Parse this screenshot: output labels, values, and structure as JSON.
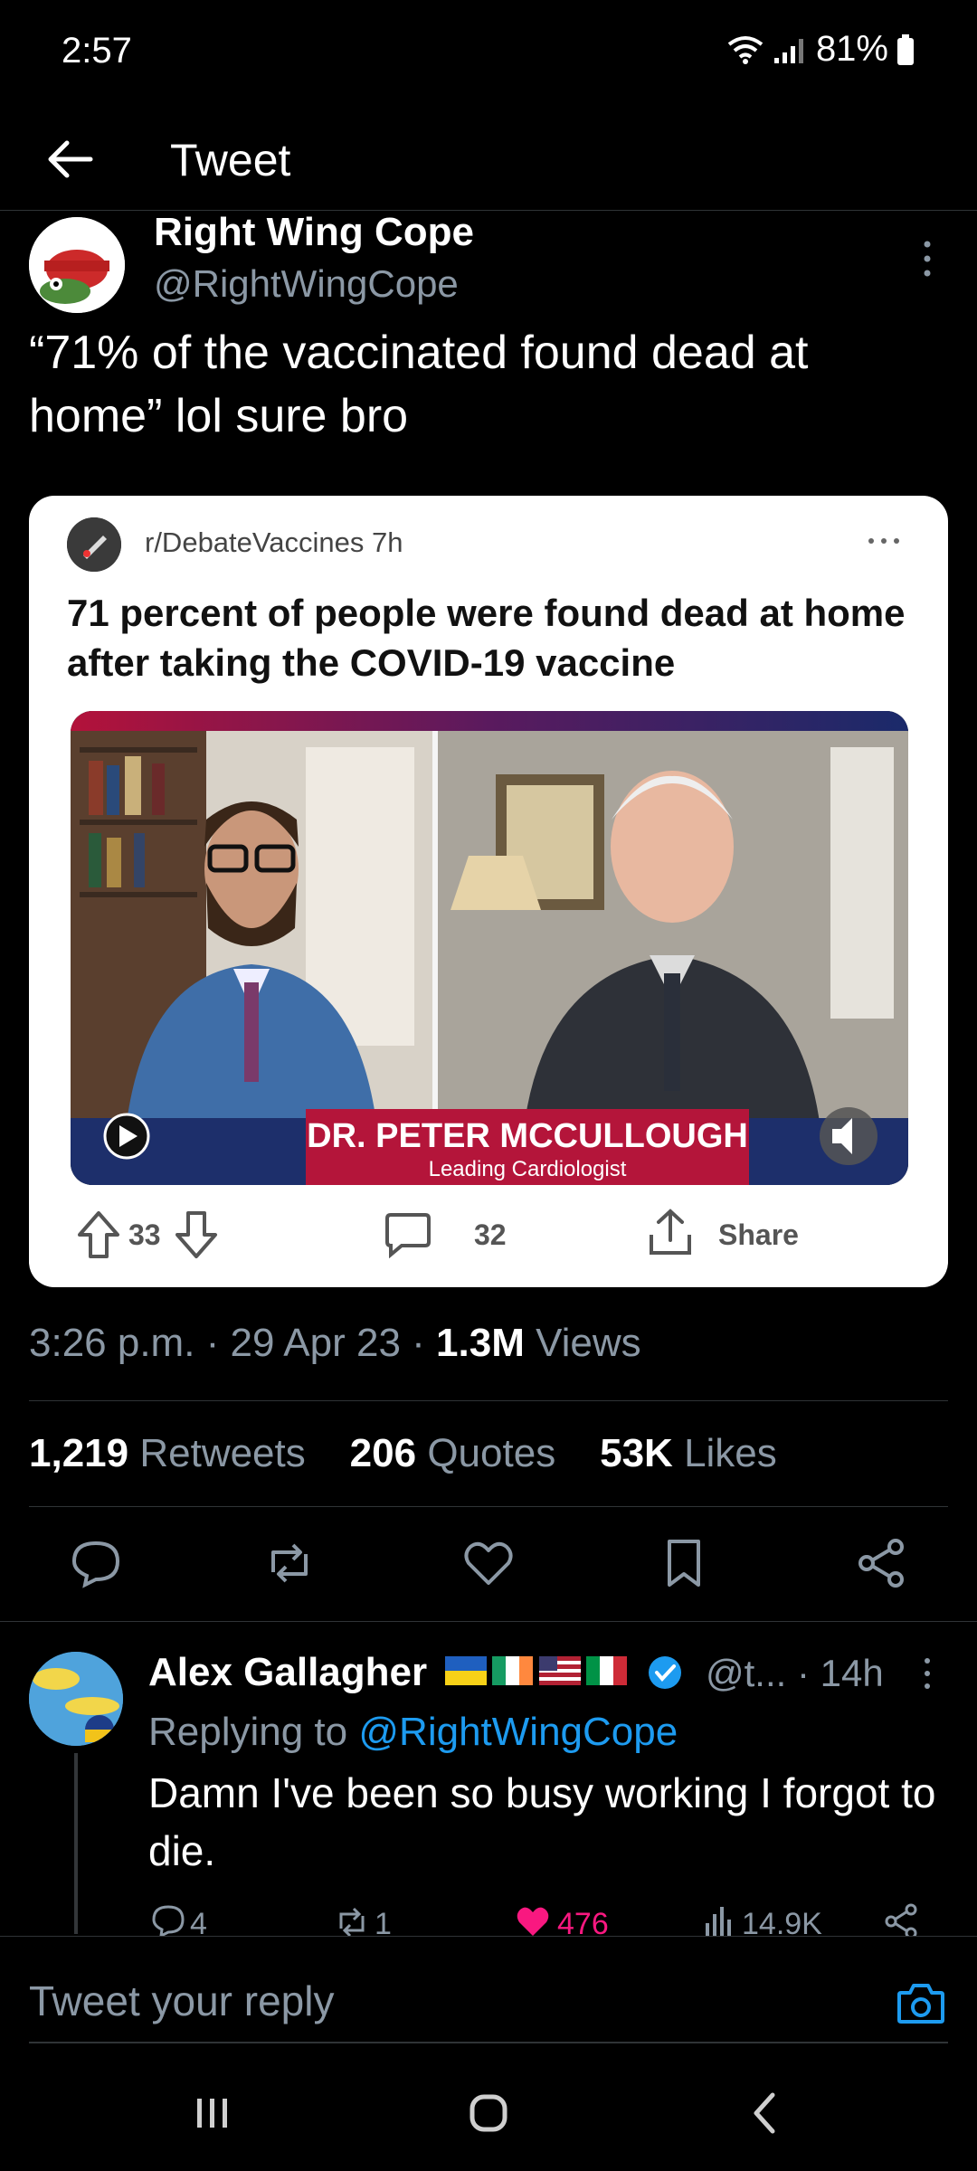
{
  "status_bar": {
    "time": "2:57",
    "battery": "81%"
  },
  "header": {
    "title": "Tweet"
  },
  "tweet": {
    "author_name": "Right Wing Cope",
    "author_handle": "@RightWingCope",
    "text": "“71% of the vaccinated found dead at home” lol sure bro",
    "card": {
      "subreddit": "r/DebateVaccines",
      "age": "7h",
      "title": "71 percent of people were found dead at home after taking the COVID-19 vaccine",
      "lower_third_name": "DR. PETER MCCULLOUGH",
      "lower_third_role": "Leading Cardiologist",
      "upvotes": "33",
      "comments": "32",
      "share_label": "Share"
    },
    "timestamp": "3:26 p.m. · 29 Apr 23 ·",
    "views_count": "1.3M",
    "views_label": "Views",
    "retweets_count": "1,219",
    "retweets_label": "Retweets",
    "quotes_count": "206",
    "quotes_label": "Quotes",
    "likes_count": "53K",
    "likes_label": "Likes"
  },
  "reply": {
    "author_name": "Alex Gallagher",
    "handle_time": "@t... · 14h",
    "replying_prefix": "Replying to",
    "replying_to": "@RightWingCope",
    "text": "Damn I've been so busy working I forgot to die.",
    "replies": "4",
    "retweets": "1",
    "likes": "476",
    "views": "14.9K"
  },
  "composer": {
    "placeholder": "Tweet your reply"
  },
  "colors": {
    "accent": "#1d9bf0",
    "like": "#f91880",
    "muted": "#8b98a5"
  }
}
